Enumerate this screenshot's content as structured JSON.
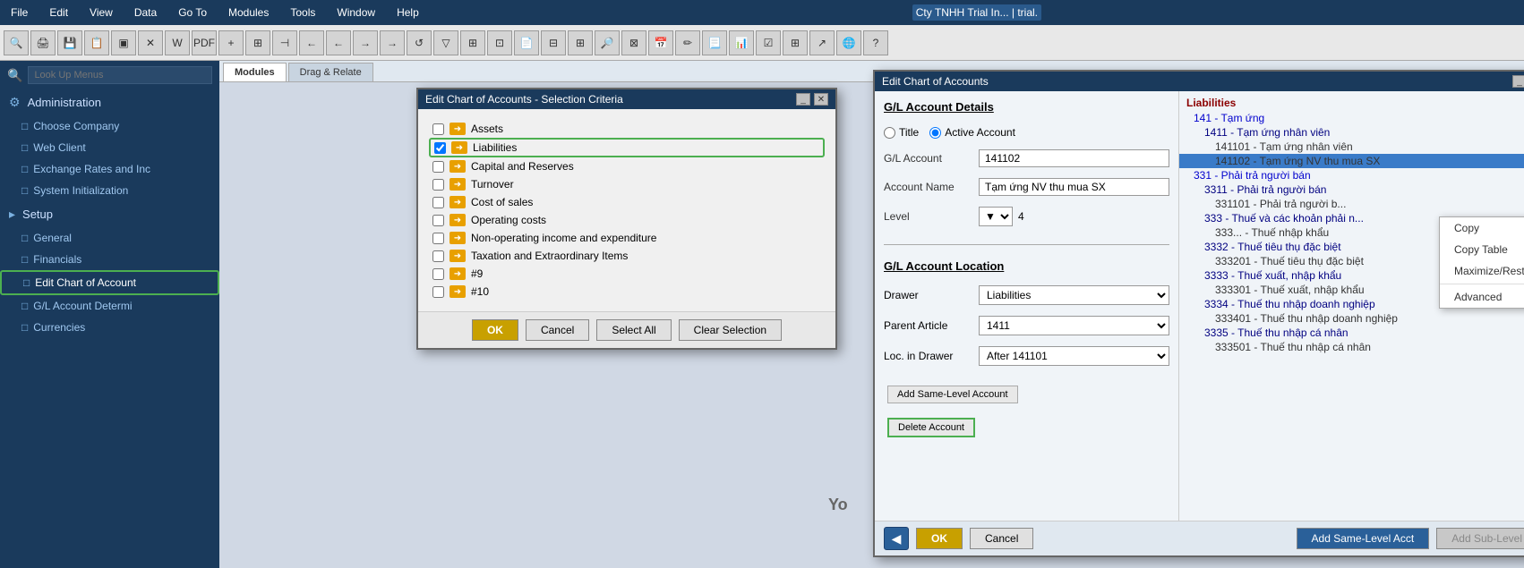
{
  "app": {
    "title": "Cty TNHH Trial In... | trial.",
    "menu_items": [
      "File",
      "Edit",
      "View",
      "Data",
      "Go To",
      "Modules",
      "Tools",
      "Window",
      "Help"
    ]
  },
  "tabs": {
    "modules_label": "Modules",
    "drag_relate_label": "Drag & Relate"
  },
  "sidebar": {
    "search_placeholder": "Look Up Menus",
    "items": [
      {
        "id": "administration",
        "label": "Administration",
        "type": "section"
      },
      {
        "id": "choose-company",
        "label": "Choose Company",
        "type": "item"
      },
      {
        "id": "web-client",
        "label": "Web Client",
        "type": "item"
      },
      {
        "id": "exchange-rates",
        "label": "Exchange Rates and Inc",
        "type": "item"
      },
      {
        "id": "system-init",
        "label": "System Initialization",
        "type": "item"
      },
      {
        "id": "setup",
        "label": "Setup",
        "type": "section"
      },
      {
        "id": "general",
        "label": "General",
        "type": "item"
      },
      {
        "id": "financials",
        "label": "Financials",
        "type": "item"
      },
      {
        "id": "edit-chart",
        "label": "Edit Chart of Account",
        "type": "item",
        "highlighted": true
      },
      {
        "id": "gl-account",
        "label": "G/L Account Determi",
        "type": "item"
      },
      {
        "id": "currencies",
        "label": "Currencies",
        "type": "item"
      }
    ]
  },
  "selection_dialog": {
    "title": "Edit Chart of Accounts - Selection Criteria",
    "items": [
      {
        "id": "assets",
        "label": "Assets",
        "checked": false
      },
      {
        "id": "liabilities",
        "label": "Liabilities",
        "checked": true,
        "highlighted": true
      },
      {
        "id": "capital",
        "label": "Capital and Reserves",
        "checked": false
      },
      {
        "id": "turnover",
        "label": "Turnover",
        "checked": false
      },
      {
        "id": "cost-sales",
        "label": "Cost of sales",
        "checked": false
      },
      {
        "id": "operating",
        "label": "Operating costs",
        "checked": false
      },
      {
        "id": "non-op",
        "label": "Non-operating income and expenditure",
        "checked": false
      },
      {
        "id": "taxation",
        "label": "Taxation and Extraordinary Items",
        "checked": false
      },
      {
        "id": "hash9",
        "label": "#9",
        "checked": false
      },
      {
        "id": "hash10",
        "label": "#10",
        "checked": false
      }
    ],
    "buttons": {
      "ok": "OK",
      "cancel": "Cancel",
      "select_all": "Select All",
      "clear_selection": "Clear Selection"
    }
  },
  "eca_dialog": {
    "title": "Edit Chart of Accounts",
    "gl_details_title": "G/L Account Details",
    "title_label": "Title",
    "active_account_label": "Active Account",
    "gl_account_label": "G/L Account",
    "gl_account_value": "141102",
    "account_name_label": "Account Name",
    "account_name_value": "Tạm ứng NV thu mua SX",
    "level_label": "Level",
    "level_value": "4",
    "gl_location_title": "G/L Account Location",
    "drawer_label": "Drawer",
    "drawer_value": "Liabilities",
    "parent_article_label": "Parent Article",
    "parent_article_value": "1411",
    "loc_in_drawer_label": "Loc. in Drawer",
    "loc_in_drawer_value": "After 141101",
    "buttons": {
      "ok": "OK",
      "cancel": "Cancel",
      "add_same": "Add Same-Level Acct",
      "add_sub": "Add Sub-Level Acct"
    },
    "tree": {
      "category": "Liabilities",
      "items": [
        {
          "level": 1,
          "text": "141 - Tạm ứng"
        },
        {
          "level": 2,
          "text": "1411 - Tạm ứng nhân viên"
        },
        {
          "level": 3,
          "text": "141101 - Tạm ứng nhân viên"
        },
        {
          "level": 3,
          "text": "141102 - Tạm ứng NV thu mua SX",
          "selected": true
        },
        {
          "level": 1,
          "text": "331 - Phải trả người bán"
        },
        {
          "level": 2,
          "text": "3311 - Phải trả người bán"
        },
        {
          "level": 3,
          "text": "331101 - Phải trả người b..."
        },
        {
          "level": 2,
          "text": "333 - Thuế và các khoản phải n..."
        },
        {
          "level": 2,
          "text": "333... - Thuế nhập khẩu"
        },
        {
          "level": 2,
          "text": "3332 - Thuế tiêu thụ đặc biệt"
        },
        {
          "level": 3,
          "text": "333201 - Thuế tiêu thụ đặc biệt"
        },
        {
          "level": 2,
          "text": "3333 - Thuế xuất, nhập khẩu"
        },
        {
          "level": 3,
          "text": "333301 - Thuế xuất, nhập khẩu"
        },
        {
          "level": 2,
          "text": "3334 - Thuế thu nhập doanh nghiệp"
        },
        {
          "level": 3,
          "text": "333401 - Thuế thu nhập doanh nghiệp"
        },
        {
          "level": 2,
          "text": "3335 - Thuế thu nhập cá nhân"
        },
        {
          "level": 3,
          "text": "333501 - Thuế thu nhập cá nhân"
        }
      ]
    },
    "tree_actions": {
      "add_same_level": "Add Same-Level Account",
      "delete_account": "Delete Account"
    }
  },
  "context_menu": {
    "items": [
      "Copy",
      "Copy Table",
      "Maximize/Restore Grid",
      "Advanced"
    ]
  },
  "yo_text": "Yo"
}
